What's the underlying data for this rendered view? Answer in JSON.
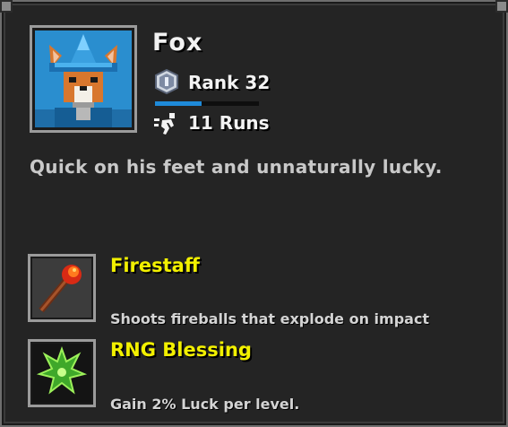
{
  "character": {
    "name": "Fox",
    "rank_label": "Rank 32",
    "rank_progress": 0.45,
    "runs_label": "11 Runs",
    "description": "Quick on his feet and unnaturally lucky."
  },
  "abilities": [
    {
      "title": "Firestaff",
      "description": "Shoots fireballs that explode on impact",
      "icon": "firestaff-icon"
    },
    {
      "title": "RNG Blessing",
      "description": "Gain 2% Luck per level.",
      "icon": "rng-blessing-icon"
    }
  ],
  "colors": {
    "title_yellow": "#f2f000",
    "progress_blue": "#1e8ad9",
    "portrait_bg": "#2a8ecf",
    "ability_bg": "#3c3c3c"
  }
}
